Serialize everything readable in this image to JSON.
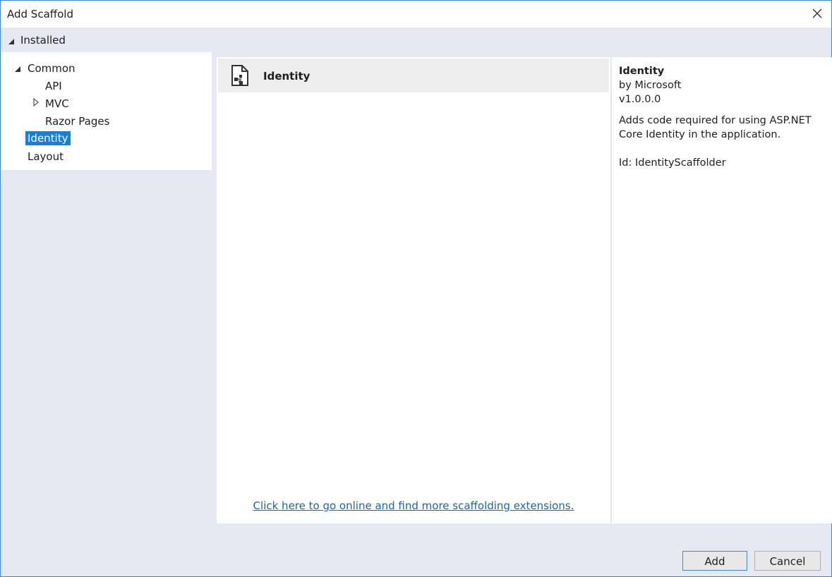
{
  "window": {
    "title": "Add Scaffold"
  },
  "installed": {
    "label": "Installed"
  },
  "tree": {
    "common": "Common",
    "api": "API",
    "mvc": "MVC",
    "razor_pages": "Razor Pages",
    "identity": "Identity",
    "layout": "Layout"
  },
  "list": {
    "items": [
      {
        "label": "Identity"
      }
    ],
    "online_link": "Click here to go online and find more scaffolding extensions."
  },
  "details": {
    "name": "Identity",
    "author": "by Microsoft",
    "version": "v1.0.0.0",
    "description": "Adds code required for using ASP.NET Core Identity in the application.",
    "id": "Id: IdentityScaffolder"
  },
  "buttons": {
    "add": "Add",
    "cancel": "Cancel"
  },
  "colors": {
    "accent": "#1a7fd4",
    "link": "#1a66b5",
    "window_border": "#3c8bc6",
    "panel_bg": "#e6e9f2"
  }
}
